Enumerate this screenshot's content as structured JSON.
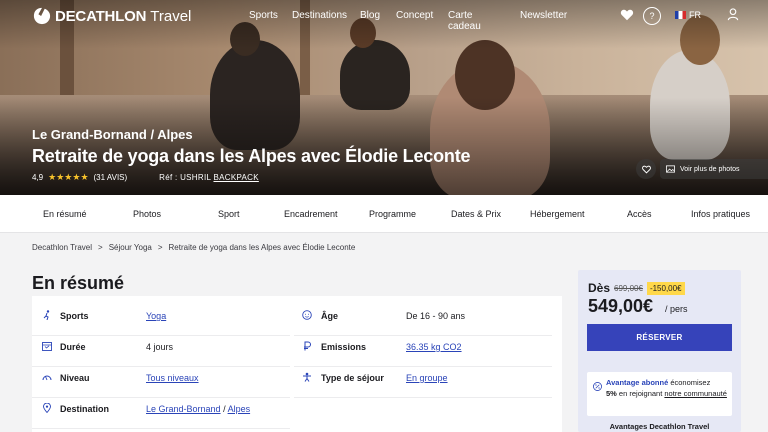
{
  "header": {
    "brand": "DECATHLON",
    "brand_sub": "Travel",
    "nav": [
      "Sports",
      "Destinations",
      "Blog",
      "Concept",
      "Carte cadeau",
      "Newsletter"
    ],
    "help_label": "?",
    "language": "FR"
  },
  "hero": {
    "location": "Le Grand-Bornand / Alpes",
    "title": "Retraite de yoga dans les Alpes avec Élodie Leconte",
    "rating": "4,9",
    "stars": 5,
    "reviews": "(31 AVIS)",
    "ref_label": "Réf : USHRIL",
    "ref_link": "BACKPACK",
    "photos_button": "Voir plus de photos"
  },
  "subnav": [
    "En résumé",
    "Photos",
    "Sport",
    "Encadrement",
    "Programme",
    "Dates & Prix",
    "Hébergement",
    "Accès",
    "Infos pratiques"
  ],
  "breadcrumb": [
    "Decathlon Travel",
    "Séjour Yoga",
    "Retraite de yoga dans les Alpes avec Élodie Leconte"
  ],
  "summary": {
    "title": "En résumé",
    "left": [
      {
        "label": "Sports",
        "value": "Yoga",
        "link": true,
        "icon": "running-icon"
      },
      {
        "label": "Durée",
        "value": "4 jours",
        "link": false,
        "icon": "calendar-icon"
      },
      {
        "label": "Niveau",
        "value": "Tous niveaux",
        "link": true,
        "icon": "gauge-icon"
      },
      {
        "label": "Destination",
        "value_a": "Le Grand-Bornand",
        "value_sep": " / ",
        "value_b": "Alpes",
        "link": true,
        "icon": "pin-icon"
      }
    ],
    "right": [
      {
        "label": "Âge",
        "value": "De 16 - 90 ans",
        "link": false,
        "icon": "face-icon"
      },
      {
        "label": "Emissions",
        "value": "36.35 kg CO2",
        "link": true,
        "icon": "co2-icon"
      },
      {
        "label": "Type de séjour",
        "value": "En groupe",
        "link": true,
        "icon": "group-icon"
      }
    ]
  },
  "booking": {
    "from_label": "Dès",
    "old_price": "699,00€",
    "discount": "-150,00€",
    "price": "549,00€",
    "per": "/ pers",
    "reserve": "RÉSERVER",
    "promo_highlight": "Avantage abonné",
    "promo_text_1": " économisez",
    "promo_bold": "5%",
    "promo_text_2": " en rejoignant ",
    "promo_link": "notre communauté",
    "advantages_title": "Avantages Decathlon Travel"
  },
  "colors": {
    "accent": "#3643ba",
    "link": "#2a44b8",
    "discount_bg": "#ffd84a",
    "star": "#f7c22b"
  }
}
